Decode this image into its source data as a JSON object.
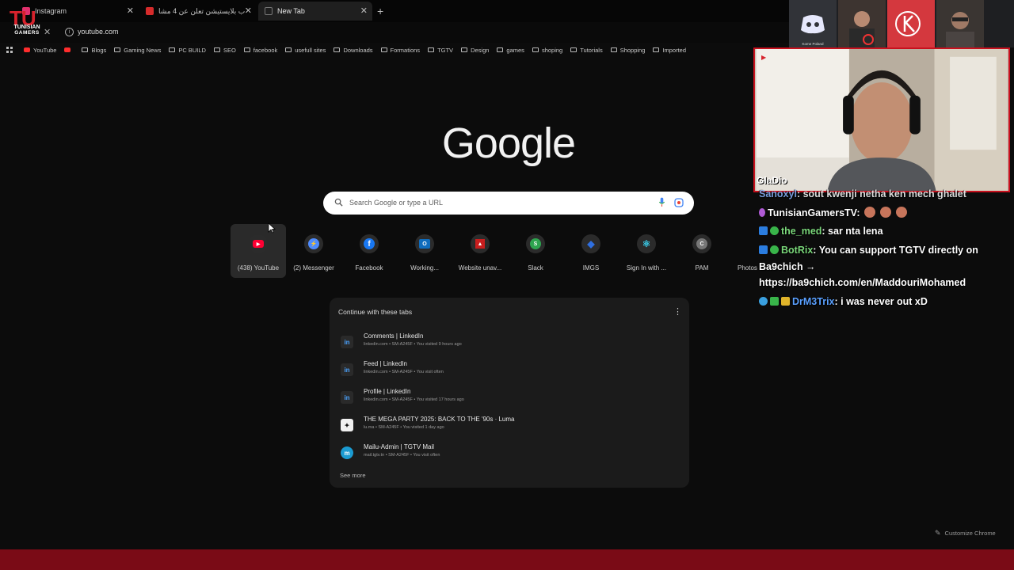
{
  "tabs": [
    {
      "title": "Instagram",
      "favicon_color": "#e1306c"
    },
    {
      "title": "ألعاب بلايستيشن تعلن عن 4 مشا...",
      "favicon_color": "#d62b2b"
    },
    {
      "title": "New Tab",
      "favicon_color": "#888888",
      "active": true
    }
  ],
  "omnibox": {
    "url": "youtube.com"
  },
  "bookmarks": [
    {
      "label": "YouTube",
      "type": "youtube"
    },
    {
      "label": "",
      "type": "youtube"
    },
    {
      "label": "Blogs",
      "type": "folder"
    },
    {
      "label": "Gaming News",
      "type": "folder"
    },
    {
      "label": "PC BUILD",
      "type": "folder"
    },
    {
      "label": "SEO",
      "type": "folder"
    },
    {
      "label": "facebook",
      "type": "folder"
    },
    {
      "label": "usefull sites",
      "type": "folder"
    },
    {
      "label": "Downloads",
      "type": "folder"
    },
    {
      "label": "Formations",
      "type": "folder"
    },
    {
      "label": "TGTV",
      "type": "folder"
    },
    {
      "label": "Design",
      "type": "folder"
    },
    {
      "label": "games",
      "type": "folder"
    },
    {
      "label": "shoping",
      "type": "folder"
    },
    {
      "label": "Tutorials",
      "type": "folder"
    },
    {
      "label": "Shopping",
      "type": "folder"
    },
    {
      "label": "Imported",
      "type": "folder"
    }
  ],
  "google": {
    "logo_text": "Google",
    "search_placeholder": "Search Google or type a URL"
  },
  "shortcuts": [
    {
      "label": "(438) YouTube",
      "icon": "youtube-icon",
      "color": "#ff0033",
      "glyph": "▶"
    },
    {
      "label": "(2) Messenger",
      "icon": "messenger-icon",
      "color": "#4f8cff",
      "glyph": "⚡"
    },
    {
      "label": "Facebook",
      "icon": "facebook-icon",
      "color": "#1877f2",
      "glyph": "f"
    },
    {
      "label": "Working...",
      "icon": "outlook-icon",
      "color": "#0f6cbd",
      "glyph": "O"
    },
    {
      "label": "Website unav...",
      "icon": "site-icon",
      "color": "#c81e1e",
      "glyph": "▲"
    },
    {
      "label": "Slack",
      "icon": "slack-icon",
      "color": "#2ea44f",
      "glyph": "S"
    },
    {
      "label": "IMGS",
      "icon": "diamond-icon",
      "color": "#2f6fe0",
      "glyph": "◆"
    },
    {
      "label": "Sign In with ...",
      "icon": "react-icon",
      "color": "#39c4e0",
      "glyph": "⚛"
    },
    {
      "label": "PAM",
      "icon": "letter-c-icon",
      "color": "#777777",
      "glyph": "C"
    },
    {
      "label": "Photos",
      "icon": "photos-icon",
      "color": "#555555",
      "glyph": ""
    }
  ],
  "continue_tabs": {
    "title": "Continue with these tabs",
    "items": [
      {
        "title": "Comments | LinkedIn",
        "sub": "linkedin.com • SM-A245F • You visited 9 hours ago",
        "icon": "linkedin-icon",
        "color": "#2a2a2a",
        "glyph": "in"
      },
      {
        "title": "Feed | LinkedIn",
        "sub": "linkedin.com • SM-A245F • You visit often",
        "icon": "linkedin-icon",
        "color": "#2a2a2a",
        "glyph": "in"
      },
      {
        "title": "Profile | LinkedIn",
        "sub": "linkedin.com • SM-A245F • You visited 17 hours ago",
        "icon": "linkedin-icon",
        "color": "#2a2a2a",
        "glyph": "in"
      },
      {
        "title": "THE MEGA PARTY 2025: BACK TO THE '90s · Luma",
        "sub": "lu.ma • SM-A245F • You visited 1 day ago",
        "icon": "luma-icon",
        "color": "#2a2a2a",
        "glyph": "✦"
      },
      {
        "title": "Mailu-Admin | TGTV Mail",
        "sub": "mail.tgtv.tn • SM-A245F • You visit often",
        "icon": "mailu-icon",
        "color": "#1b9bd1",
        "glyph": "m"
      }
    ],
    "see_more": "See more"
  },
  "customize_label": "Customize Chrome",
  "overlay": {
    "logo_tu": "TU",
    "logo_line1": "TUNISIAN",
    "logo_line2": "GAMERS",
    "discord_names": [
      "Kome Poland",
      "",
      "",
      ""
    ],
    "cam_name": "GlaDio",
    "chat": [
      {
        "user": "Sanoxyl",
        "text": ": sout kwenji netha ken mech ghalet",
        "user_color": "#8ab4ff"
      },
      {
        "user": "TunisianGamersTV",
        "text": ":",
        "user_color": "#ffffff"
      },
      {
        "user": "the_med",
        "text": ": sar nta lena",
        "user_color": "#7bd87b"
      },
      {
        "user": "BotRix",
        "text": ": You can support TGTV directly on",
        "user_color": "#7bd87b"
      },
      {
        "user": "",
        "text": "Ba9chich →",
        "user_color": "#ffffff"
      },
      {
        "user": "",
        "text": "https://ba9chich.com/en/MaddouriMohamed",
        "user_color": "#ffffff"
      },
      {
        "user": "DrM3Trix",
        "text": ": i was never out xD",
        "user_color": "#5aa0ff"
      }
    ]
  }
}
